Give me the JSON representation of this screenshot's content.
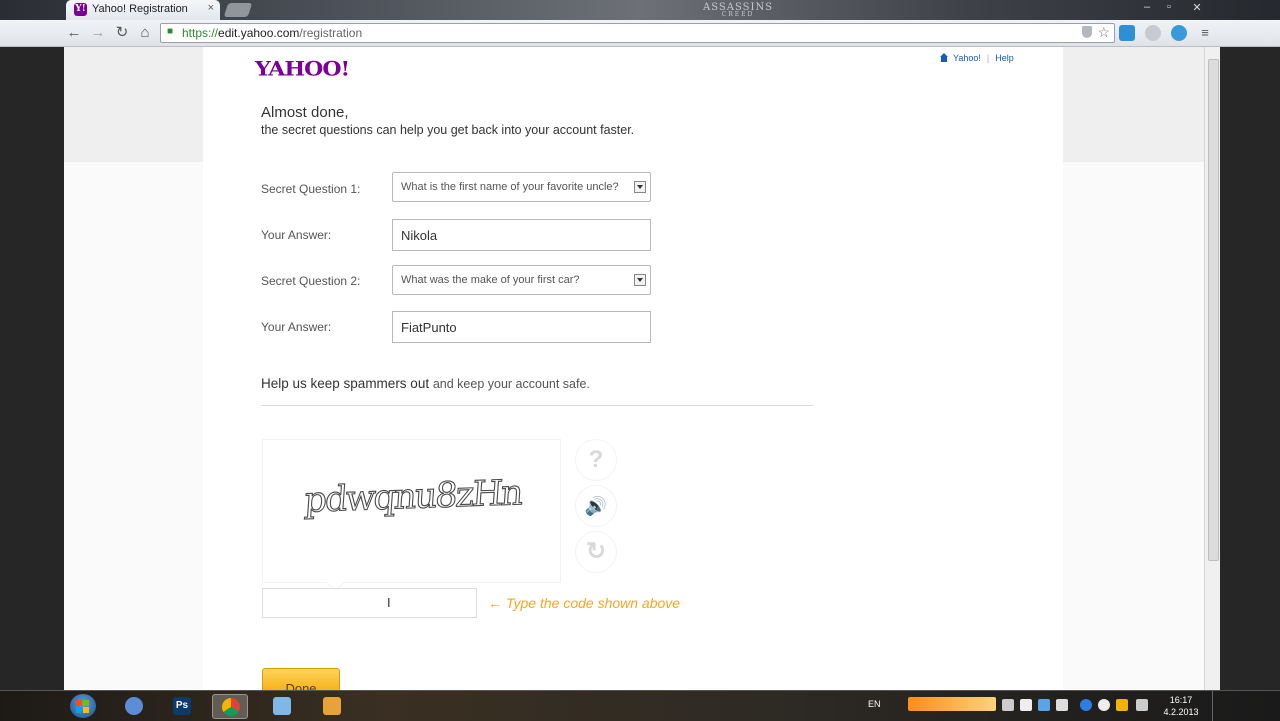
{
  "browser": {
    "tab_title": "Yahoo! Registration",
    "tab_favicon_letter": "Y!",
    "tab_close": "×",
    "brand_top": "ASSASSINS",
    "brand_bottom": "CREED",
    "window_controls": [
      "–",
      "▫",
      "✕"
    ],
    "back": "←",
    "forward": "→",
    "reload": "↻",
    "home": "⌂",
    "url_scheme": "https://",
    "url_host": "edit.yahoo.com",
    "url_path": "/registration",
    "menu": "≡"
  },
  "page": {
    "logo": "YAHOO!",
    "toplinks": [
      "Yahoo!",
      "Help"
    ],
    "heading": "Almost done,",
    "subheading": "the secret questions can help you get back into your account faster.",
    "fields": [
      {
        "label": "Secret Question 1:",
        "value": "What is the first name of your favorite uncle?"
      },
      {
        "label": "Your Answer:",
        "value": "Nikola"
      },
      {
        "label": "Secret Question 2:",
        "value": "What was the make of your first car?"
      },
      {
        "label": "Your Answer:",
        "value": "FiatPunto"
      }
    ],
    "spam_heading_bold": "Help us keep spammers out",
    "spam_heading_rest": "and keep your account safe.",
    "captcha_text": "pdwqnu8zHn",
    "captcha_buttons": [
      "?",
      "🔊",
      "↻"
    ],
    "code_cursor": "I",
    "code_hint": "Type the code shown above",
    "code_hint_arrow": "←",
    "done_label": "Done"
  },
  "taskbar": {
    "lang": "EN",
    "time": "16:17",
    "date": "4.2.2013",
    "ps_label": "Ps"
  },
  "colors": {
    "yahoo_purple": "#7b0099",
    "link_blue": "#1a5ab8",
    "hint_orange": "#f5a623",
    "done_yellow": "#f2a908"
  }
}
